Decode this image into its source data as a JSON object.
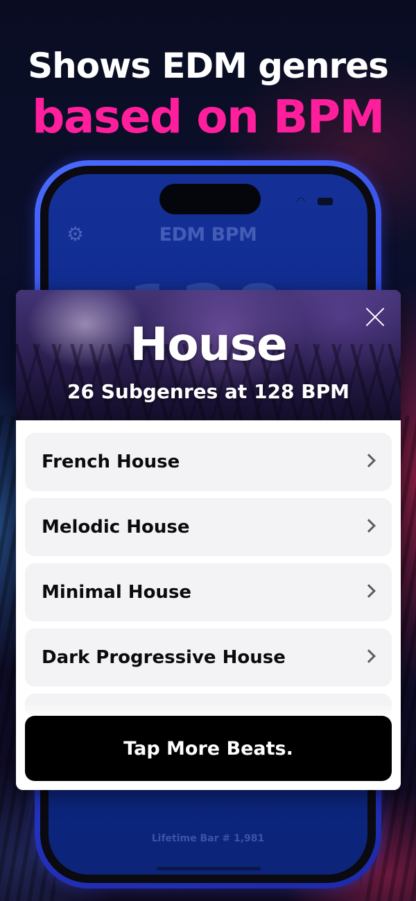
{
  "headline": {
    "line1": "Shows EDM genres",
    "line2": "based on BPM"
  },
  "colors": {
    "accent_pink": "#ff1f9c",
    "phone_frame": "#2a3fd8",
    "cta_background": "#000000"
  },
  "phone": {
    "app_title": "EDM BPM",
    "bpm_value": "128",
    "lifetime_bar": "Lifetime Bar # 1,981",
    "icons": [
      "gear-icon",
      "wifi-icon",
      "battery-icon"
    ]
  },
  "modal": {
    "genre": "House",
    "subtitle": "26 Subgenres at 128 BPM",
    "subgenres": [
      "French House",
      "Melodic House",
      "Minimal House",
      "Dark Progressive House"
    ],
    "cta_label": "Tap More Beats.",
    "icons": [
      "close-icon",
      "chevron-right-icon"
    ]
  }
}
